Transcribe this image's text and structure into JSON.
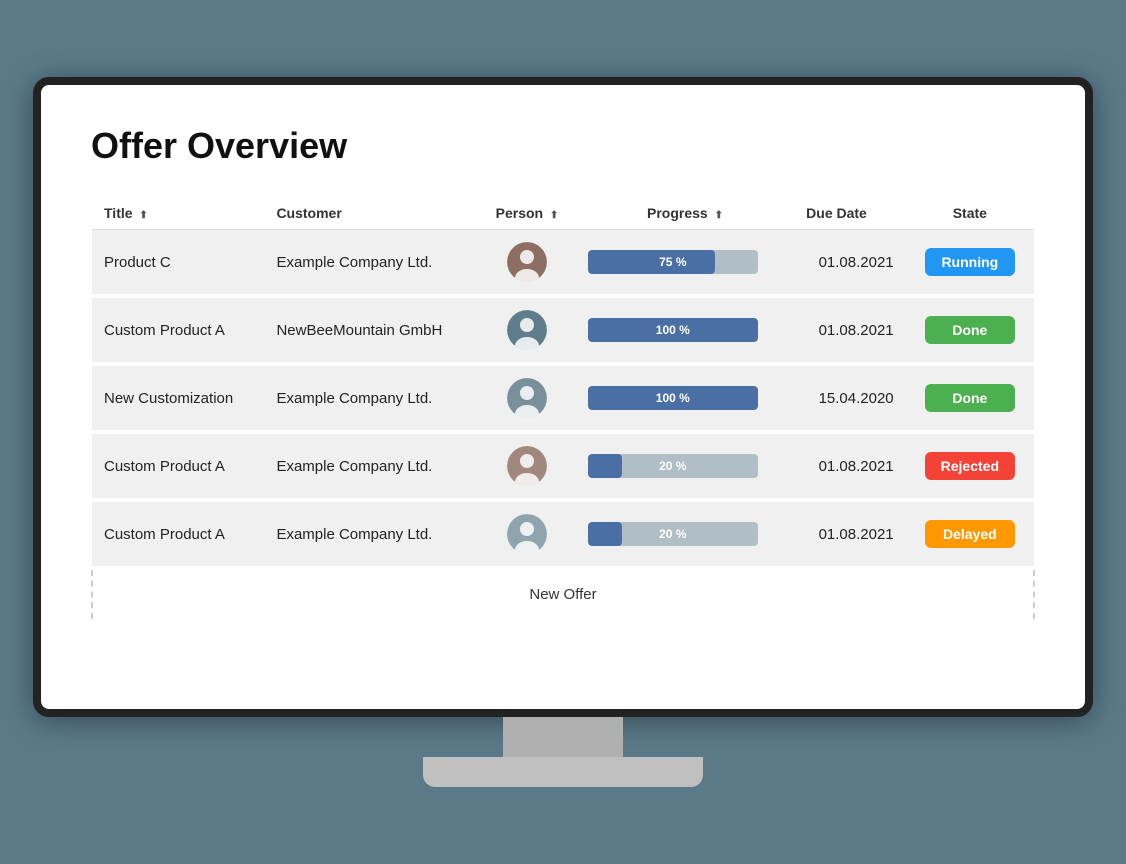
{
  "page": {
    "title": "Offer Overview"
  },
  "table": {
    "columns": [
      {
        "id": "title",
        "label": "Title",
        "sortable": true
      },
      {
        "id": "customer",
        "label": "Customer",
        "sortable": false
      },
      {
        "id": "person",
        "label": "Person",
        "sortable": true
      },
      {
        "id": "progress",
        "label": "Progress",
        "sortable": true
      },
      {
        "id": "due_date",
        "label": "Due Date",
        "sortable": false
      },
      {
        "id": "state",
        "label": "State",
        "sortable": false
      }
    ],
    "rows": [
      {
        "id": 1,
        "title": "Product C",
        "customer": "Example Company Ltd.",
        "person_color": "#8d6e63",
        "progress_pct": 75,
        "progress_label": "75 %",
        "due_date": "01.08.2021",
        "state": "Running",
        "state_class": "state-running"
      },
      {
        "id": 2,
        "title": "Custom Product A",
        "customer": "NewBeeMountain GmbH",
        "person_color": "#607d8b",
        "progress_pct": 100,
        "progress_label": "100 %",
        "due_date": "01.08.2021",
        "state": "Done",
        "state_class": "state-done"
      },
      {
        "id": 3,
        "title": "New Customization",
        "customer": "Example Company Ltd.",
        "person_color": "#78909c",
        "progress_pct": 100,
        "progress_label": "100 %",
        "due_date": "15.04.2020",
        "state": "Done",
        "state_class": "state-done"
      },
      {
        "id": 4,
        "title": "Custom Product A",
        "customer": "Example Company Ltd.",
        "person_color": "#a1887f",
        "progress_pct": 20,
        "progress_label": "20 %",
        "due_date": "01.08.2021",
        "state": "Rejected",
        "state_class": "state-rejected"
      },
      {
        "id": 5,
        "title": "Custom Product A",
        "customer": "Example Company Ltd.",
        "person_color": "#90a4ae",
        "progress_pct": 20,
        "progress_label": "20 %",
        "due_date": "01.08.2021",
        "state": "Delayed",
        "state_class": "state-delayed"
      }
    ],
    "new_offer_label": "New Offer"
  }
}
